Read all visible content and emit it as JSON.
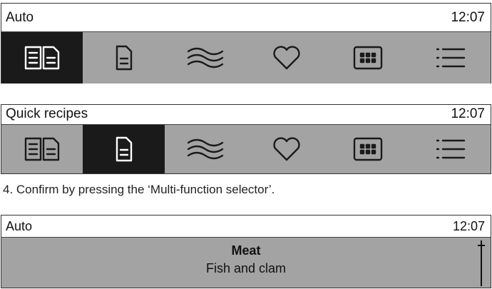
{
  "screen1": {
    "title": "Auto",
    "time": "12:07",
    "active_tab": 0
  },
  "screen2": {
    "title": "Quick recipes",
    "time": "12:07",
    "active_tab": 1
  },
  "tabs": [
    {
      "icon": "book-icon"
    },
    {
      "icon": "document-icon"
    },
    {
      "icon": "waves-icon"
    },
    {
      "icon": "heart-icon"
    },
    {
      "icon": "grid-icon"
    },
    {
      "icon": "list-icon"
    }
  ],
  "instruction": "4.  Confirm by pressing the ‘Multi-function selector’.",
  "screen3": {
    "title": "Auto",
    "time": "12:07",
    "item_primary": "Meat",
    "item_secondary": "Fish and clam"
  },
  "colors": {
    "tab_bar_bg": "#a3a3a3",
    "active_tab_bg": "#1a1a1a"
  }
}
